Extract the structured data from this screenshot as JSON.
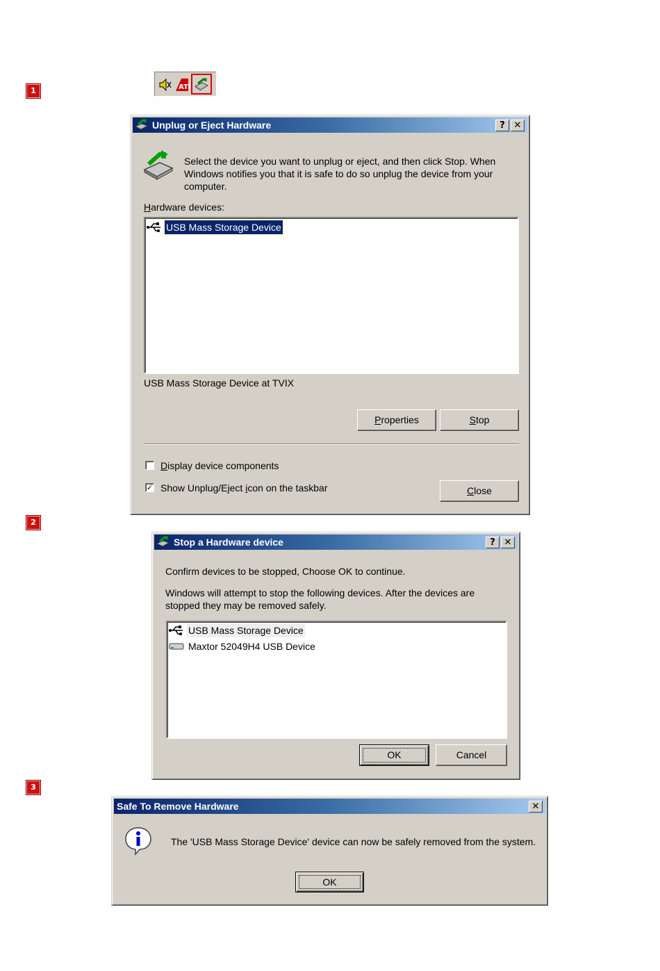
{
  "steps": [
    "1",
    "2",
    "3"
  ],
  "tray": {
    "icons": [
      "speaker-icon",
      "ati-icon",
      "unplug-eject-icon"
    ],
    "ati_label": "ATI"
  },
  "unplug_dialog": {
    "title": "Unplug or Eject Hardware",
    "help_button": "?",
    "close_button": "✕",
    "instruction": "Select the device you want to unplug or eject, and then click Stop. When Windows notifies you that it is safe to do so unplug the device from your computer.",
    "list_label": "Hardware devices:",
    "list_label_accel": "H",
    "list_label_rest": "ardware devices:",
    "devices": [
      {
        "label": "USB Mass Storage Device",
        "icon": "usb-icon",
        "selected": true
      }
    ],
    "device_location": "USB Mass Storage Device at TVIX",
    "properties_button": {
      "accel": "P",
      "rest": "roperties"
    },
    "stop_button": {
      "accel": "S",
      "rest": "top"
    },
    "display_components": {
      "accel": "D",
      "rest": "isplay device components",
      "checked": false
    },
    "show_icon": {
      "before": "Show Unplug/Eject ",
      "accel": "i",
      "after": "con on the taskbar",
      "checked": true
    },
    "close_button_label": {
      "accel": "C",
      "rest": "lose"
    }
  },
  "stop_dialog": {
    "title": "Stop a Hardware device",
    "help_button": "?",
    "close_button": "✕",
    "confirm_text": "Confirm devices to be stopped, Choose OK to continue.",
    "info_text": "Windows will attempt to stop the following devices. After the devices are stopped they may be removed safely.",
    "devices": [
      {
        "label": "USB Mass Storage Device",
        "icon": "usb-icon"
      },
      {
        "label": "Maxtor 52049H4 USB Device",
        "icon": "disk-drive-icon"
      }
    ],
    "ok_button": "OK",
    "cancel_button": "Cancel"
  },
  "safe_dialog": {
    "title": "Safe To Remove Hardware",
    "close_button": "✕",
    "message": "The 'USB Mass Storage Device' device can now be safely removed from the system.",
    "ok_button": "OK"
  }
}
